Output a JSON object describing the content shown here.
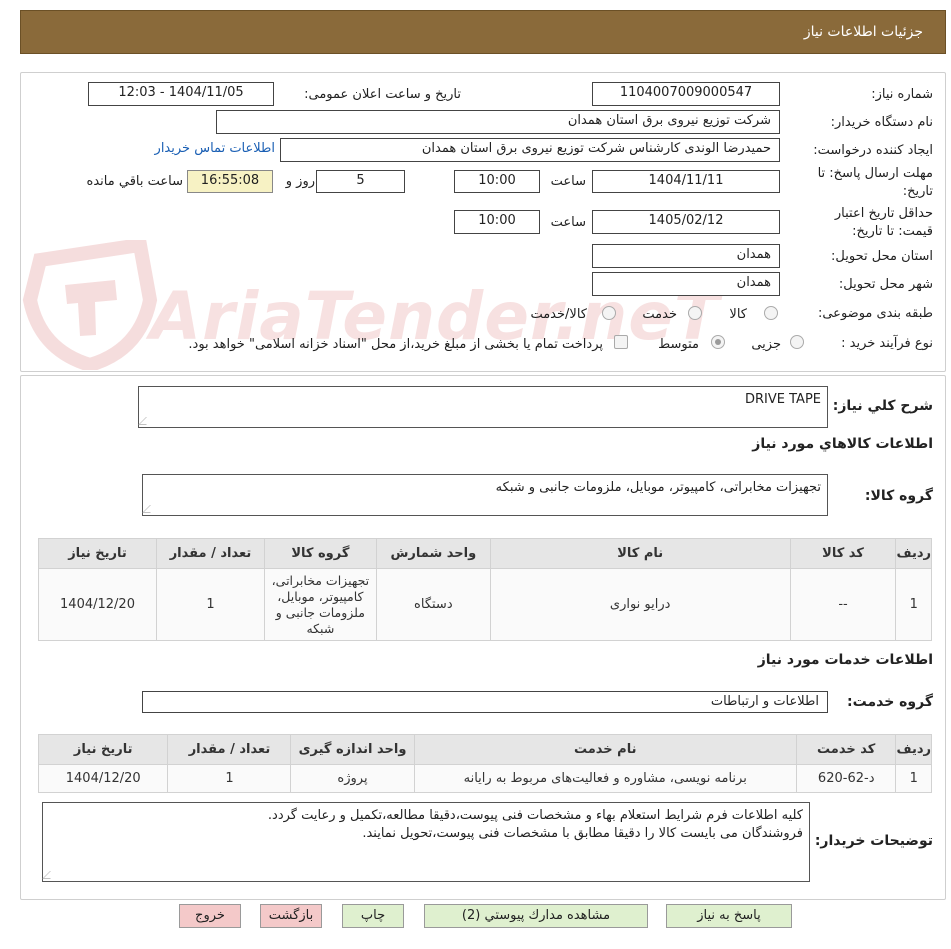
{
  "header": {
    "title": "جزئیات اطلاعات نیاز"
  },
  "watermark": {
    "text": "AriaTender.neT"
  },
  "info": {
    "need_number_label": "شماره نیاز:",
    "need_number": "1104007009000547",
    "announce_label": "تاریخ و ساعت اعلان عمومی:",
    "announce_value": "1404/11/05 - 12:03",
    "buyer_label": "نام دستگاه خریدار:",
    "buyer_value": "شرکت توزیع نیروی برق استان همدان",
    "requester_label": "ایجاد کننده درخواست:",
    "requester_value": "حمیدرضا الوندی کارشناس شرکت توزیع نیروی برق استان همدان",
    "contact_link": "اطلاعات تماس خریدار",
    "deadline_label_1": "مهلت ارسال پاسخ: تا",
    "deadline_label_2": "تاریخ:",
    "deadline_date": "1404/11/11",
    "hour_label": "ساعت",
    "deadline_time": "10:00",
    "days_value": "5",
    "days_label": "روز و",
    "remaining_time": "16:55:08",
    "remaining_label": "ساعت باقي مانده",
    "validity_label_1": "حداقل تاریخ اعتبار",
    "validity_label_2": "قیمت: تا تاریخ:",
    "validity_date": "1405/02/12",
    "validity_time": "10:00",
    "province_label": "استان محل تحویل:",
    "province_value": "همدان",
    "city_label": "شهر محل تحویل:",
    "city_value": "همدان",
    "category_label": "طبقه بندی موضوعی:",
    "category_options": [
      "کالا",
      "خدمت",
      "کالا/خدمت"
    ],
    "process_label": "نوع فرآیند خرید :",
    "process_options": [
      "جزیی",
      "متوسط"
    ],
    "payment_note": "پرداخت تمام یا بخشی از مبلغ خرید،از محل \"اسناد خزانه اسلامی\" خواهد بود."
  },
  "summary": {
    "label": "شرح کلي نیاز:",
    "value": "DRIVE TAPE"
  },
  "goods": {
    "section_title": "اطلاعات کالاهاي مورد نیاز",
    "group_label": "گروه کالا:",
    "group_value": "تجهیزات مخابراتی، کامپیوتر، موبایل، ملزومات جانبی و شبکه",
    "headers": [
      "ردیف",
      "کد کالا",
      "نام کالا",
      "واحد شمارش",
      "گروه کالا",
      "تعداد / مقدار",
      "تاریخ نیاز"
    ],
    "rows": [
      [
        "1",
        "--",
        "درایو نواری",
        "دستگاه",
        "تجهیزات مخابراتی، کامپیوتر، موبایل، ملزومات جانبی و شبکه",
        "1",
        "1404/12/20"
      ]
    ]
  },
  "services": {
    "section_title": "اطلاعات خدمات مورد نیاز",
    "group_label": "گروه خدمت:",
    "group_value": "اطلاعات و ارتباطات",
    "headers": [
      "ردیف",
      "کد خدمت",
      "نام خدمت",
      "واحد اندازه گیری",
      "تعداد / مقدار",
      "تاریخ نیاز"
    ],
    "rows": [
      [
        "1",
        "د-62-620",
        "برنامه نویسی، مشاوره و فعالیت‌های مربوط به رایانه",
        "پروژه",
        "1",
        "1404/12/20"
      ]
    ]
  },
  "notes": {
    "label": "توضیحات خریدار:",
    "line1": "کلیه اطلاعات فرم شرایط استعلام بهاء و مشخصات فنی پیوست،دقیقا مطالعه،تکمیل و رعایت گردد.",
    "line2": "فروشندگان می بایست کالا را دقیقا مطابق با مشخصات فنی پیوست،تحویل نمایند."
  },
  "buttons": {
    "reply": "پاسخ به نیاز",
    "attachments": "مشاهده مدارك پیوستي (2)",
    "print": "چاپ",
    "back": "بازگشت",
    "exit": "خروج"
  }
}
